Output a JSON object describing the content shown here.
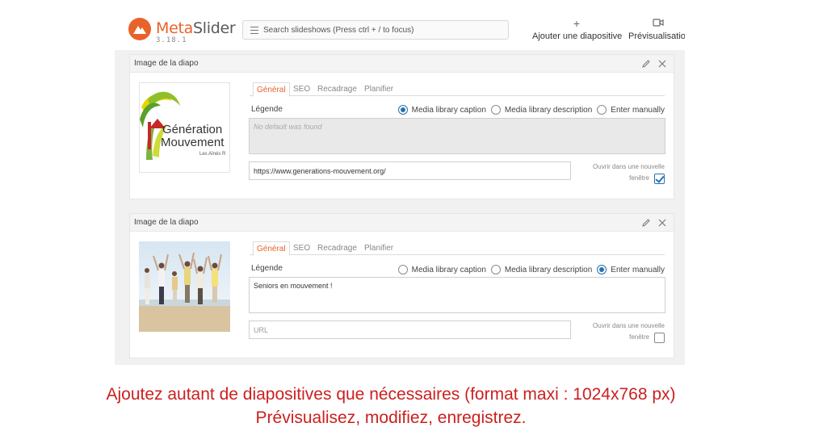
{
  "header": {
    "brand_meta": "Meta",
    "brand_slider": "Slider",
    "version": "3.18.1",
    "search_placeholder": "Search slideshows (Press ctrl + / to focus)",
    "add_slide_icon": "+",
    "add_slide_label": "Ajouter une diapositive",
    "preview_label": "Prévisualisation"
  },
  "slides": [
    {
      "title": "Image de la diapo",
      "thumbnail_text_line1": "Génération",
      "thumbnail_text_line2": "Mouvement",
      "thumbnail_text_line3": "Les Aînés R",
      "tabs": [
        "Général",
        "SEO",
        "Recadrage",
        "Planifier"
      ],
      "active_tab": "Général",
      "legend_label": "Légende",
      "caption_options": [
        "Media library caption",
        "Media library description",
        "Enter manually"
      ],
      "selected_option": "Media library caption",
      "caption_text": "No default was found",
      "url_value": "https://www.generations-mouvement.org/",
      "new_window_line1": "Ouvrir dans une nouvelle",
      "new_window_line2": "fenêtre",
      "new_window_checked": true
    },
    {
      "title": "Image de la diapo",
      "tabs": [
        "Général",
        "SEO",
        "Recadrage",
        "Planifier"
      ],
      "active_tab": "Général",
      "legend_label": "Légende",
      "caption_options": [
        "Media library caption",
        "Media library description",
        "Enter manually"
      ],
      "selected_option": "Enter manually",
      "caption_text": "Seniors en mouvement !",
      "url_placeholder": "URL",
      "new_window_line1": "Ouvrir dans une nouvelle",
      "new_window_line2": "fenêtre",
      "new_window_checked": false
    }
  ],
  "instructions": {
    "line1": "Ajoutez autant de diapositives que nécessaires (format maxi : 1024x768 px)",
    "line2": "Prévisualisez, modifiez, enregistrez."
  },
  "colors": {
    "brand": "#e8632a",
    "radio_selected": "#2271b1",
    "instructions": "#cc1f1f"
  }
}
